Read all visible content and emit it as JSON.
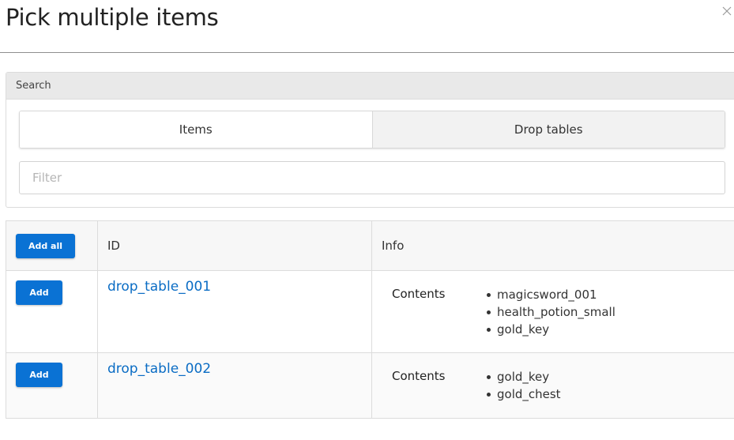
{
  "modal": {
    "title": "Pick multiple items",
    "close_icon": "close-icon"
  },
  "search": {
    "header": "Search",
    "tabs": [
      {
        "label": "Items",
        "active": true
      },
      {
        "label": "Drop tables",
        "active": false
      }
    ],
    "filter": {
      "value": "",
      "placeholder": "Filter"
    }
  },
  "table": {
    "add_all_label": "Add all",
    "columns": {
      "id": "ID",
      "info": "Info"
    },
    "rows": [
      {
        "add_label": "Add",
        "id": "drop_table_001",
        "info_label": "Contents",
        "contents": [
          "magicsword_001",
          "health_potion_small",
          "gold_key"
        ]
      },
      {
        "add_label": "Add",
        "id": "drop_table_002",
        "info_label": "Contents",
        "contents": [
          "gold_key",
          "gold_chest"
        ]
      }
    ]
  },
  "colors": {
    "primary_button": "#0a72d4",
    "link": "#0a6cc4"
  }
}
